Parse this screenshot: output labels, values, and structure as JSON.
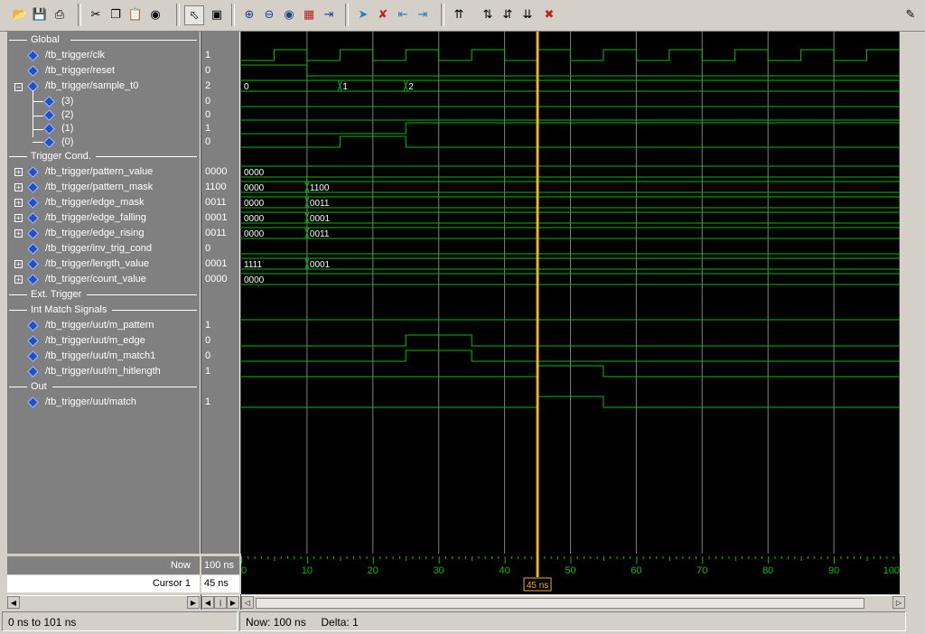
{
  "toolbar": {
    "buttons": [
      "open-icon",
      "save-icon",
      "print-icon",
      "cut-icon",
      "copy-icon",
      "paste-icon",
      "find-icon",
      "select-pointer-icon",
      "zoom-mode-icon",
      "zoom-in-icon",
      "zoom-out-icon",
      "zoom-full-icon",
      "zoom-cursor-icon",
      "expand-signal-icon",
      "add-cursor-icon",
      "delete-cursor-icon",
      "prev-edge-icon",
      "next-edge-icon",
      "insert-divider-icon",
      "align-up-icon",
      "align-down-icon",
      "move-down-icon",
      "delete-icon",
      "dock-icon"
    ]
  },
  "groups": {
    "global": "Global",
    "trigger": "Trigger Cond.",
    "ext": "Ext. Trigger",
    "intmatch": "Int Match Signals",
    "out": "Out"
  },
  "signals": [
    {
      "name": "/tb_trigger/clk",
      "value": "1"
    },
    {
      "name": "/tb_trigger/reset",
      "value": "0"
    },
    {
      "name": "/tb_trigger/sample_t0",
      "value": "2"
    },
    {
      "name": "(3)",
      "value": "0"
    },
    {
      "name": "(2)",
      "value": "0"
    },
    {
      "name": "(1)",
      "value": "1"
    },
    {
      "name": "(0)",
      "value": "0"
    },
    {
      "name": "/tb_trigger/pattern_value",
      "value": "0000"
    },
    {
      "name": "/tb_trigger/pattern_mask",
      "value": "1100"
    },
    {
      "name": "/tb_trigger/edge_mask",
      "value": "0011"
    },
    {
      "name": "/tb_trigger/edge_falling",
      "value": "0001"
    },
    {
      "name": "/tb_trigger/edge_rising",
      "value": "0011"
    },
    {
      "name": "/tb_trigger/inv_trig_cond",
      "value": "0"
    },
    {
      "name": "/tb_trigger/length_value",
      "value": "0001"
    },
    {
      "name": "/tb_trigger/count_value",
      "value": "0000"
    },
    {
      "name": "/tb_trigger/uut/m_pattern",
      "value": "1"
    },
    {
      "name": "/tb_trigger/uut/m_edge",
      "value": "0"
    },
    {
      "name": "/tb_trigger/uut/m_match1",
      "value": "0"
    },
    {
      "name": "/tb_trigger/uut/m_hitlength",
      "value": "1"
    },
    {
      "name": "/tb_trigger/uut/match",
      "value": "1"
    }
  ],
  "bus_labels": {
    "sample_t0": [
      "0",
      "1",
      "2"
    ],
    "pattern_value": [
      "0000"
    ],
    "pattern_mask": [
      "0000",
      "1100"
    ],
    "edge_mask": [
      "0000",
      "0011"
    ],
    "edge_falling": [
      "0000",
      "0001"
    ],
    "edge_rising": [
      "0000",
      "0011"
    ],
    "length_value": [
      "1111",
      "0001"
    ],
    "count_value": [
      "0000"
    ]
  },
  "waveforms": {
    "time_range_ns": [
      0,
      100
    ],
    "clk_period_ns": 10,
    "clk_high_first_ns": 5,
    "reset_low_after_ns": 10,
    "sample_t0_changes_ns": [
      0,
      15,
      25
    ],
    "sample_bit0_high_ns": [
      15,
      25
    ],
    "sample_bit1_high_from_ns": 25,
    "bus_change_ns": 10,
    "m_edge_high_ns": [
      25,
      35
    ],
    "m_match1_high_ns": [
      25,
      35
    ],
    "m_hitlength_high_ns": [
      45,
      55
    ],
    "match_high_ns": [
      45,
      55
    ]
  },
  "timeline": {
    "ticks": [
      "0",
      "10",
      "20",
      "30",
      "40",
      "50",
      "60",
      "70",
      "80",
      "90",
      "100"
    ],
    "now_label": "Now",
    "now_value": "100 ns",
    "cursor_label": "Cursor 1",
    "cursor_value": "45 ns",
    "cursor_ns": 45,
    "cursor_marker": "45 ns"
  },
  "status": {
    "range": "0 ns to 101 ns",
    "now": "Now: 100 ns",
    "delta": "Delta: 1"
  },
  "colors": {
    "wave": "#00c000",
    "cursor": "#f0b020",
    "grid": "#808080",
    "background": "#000000"
  }
}
